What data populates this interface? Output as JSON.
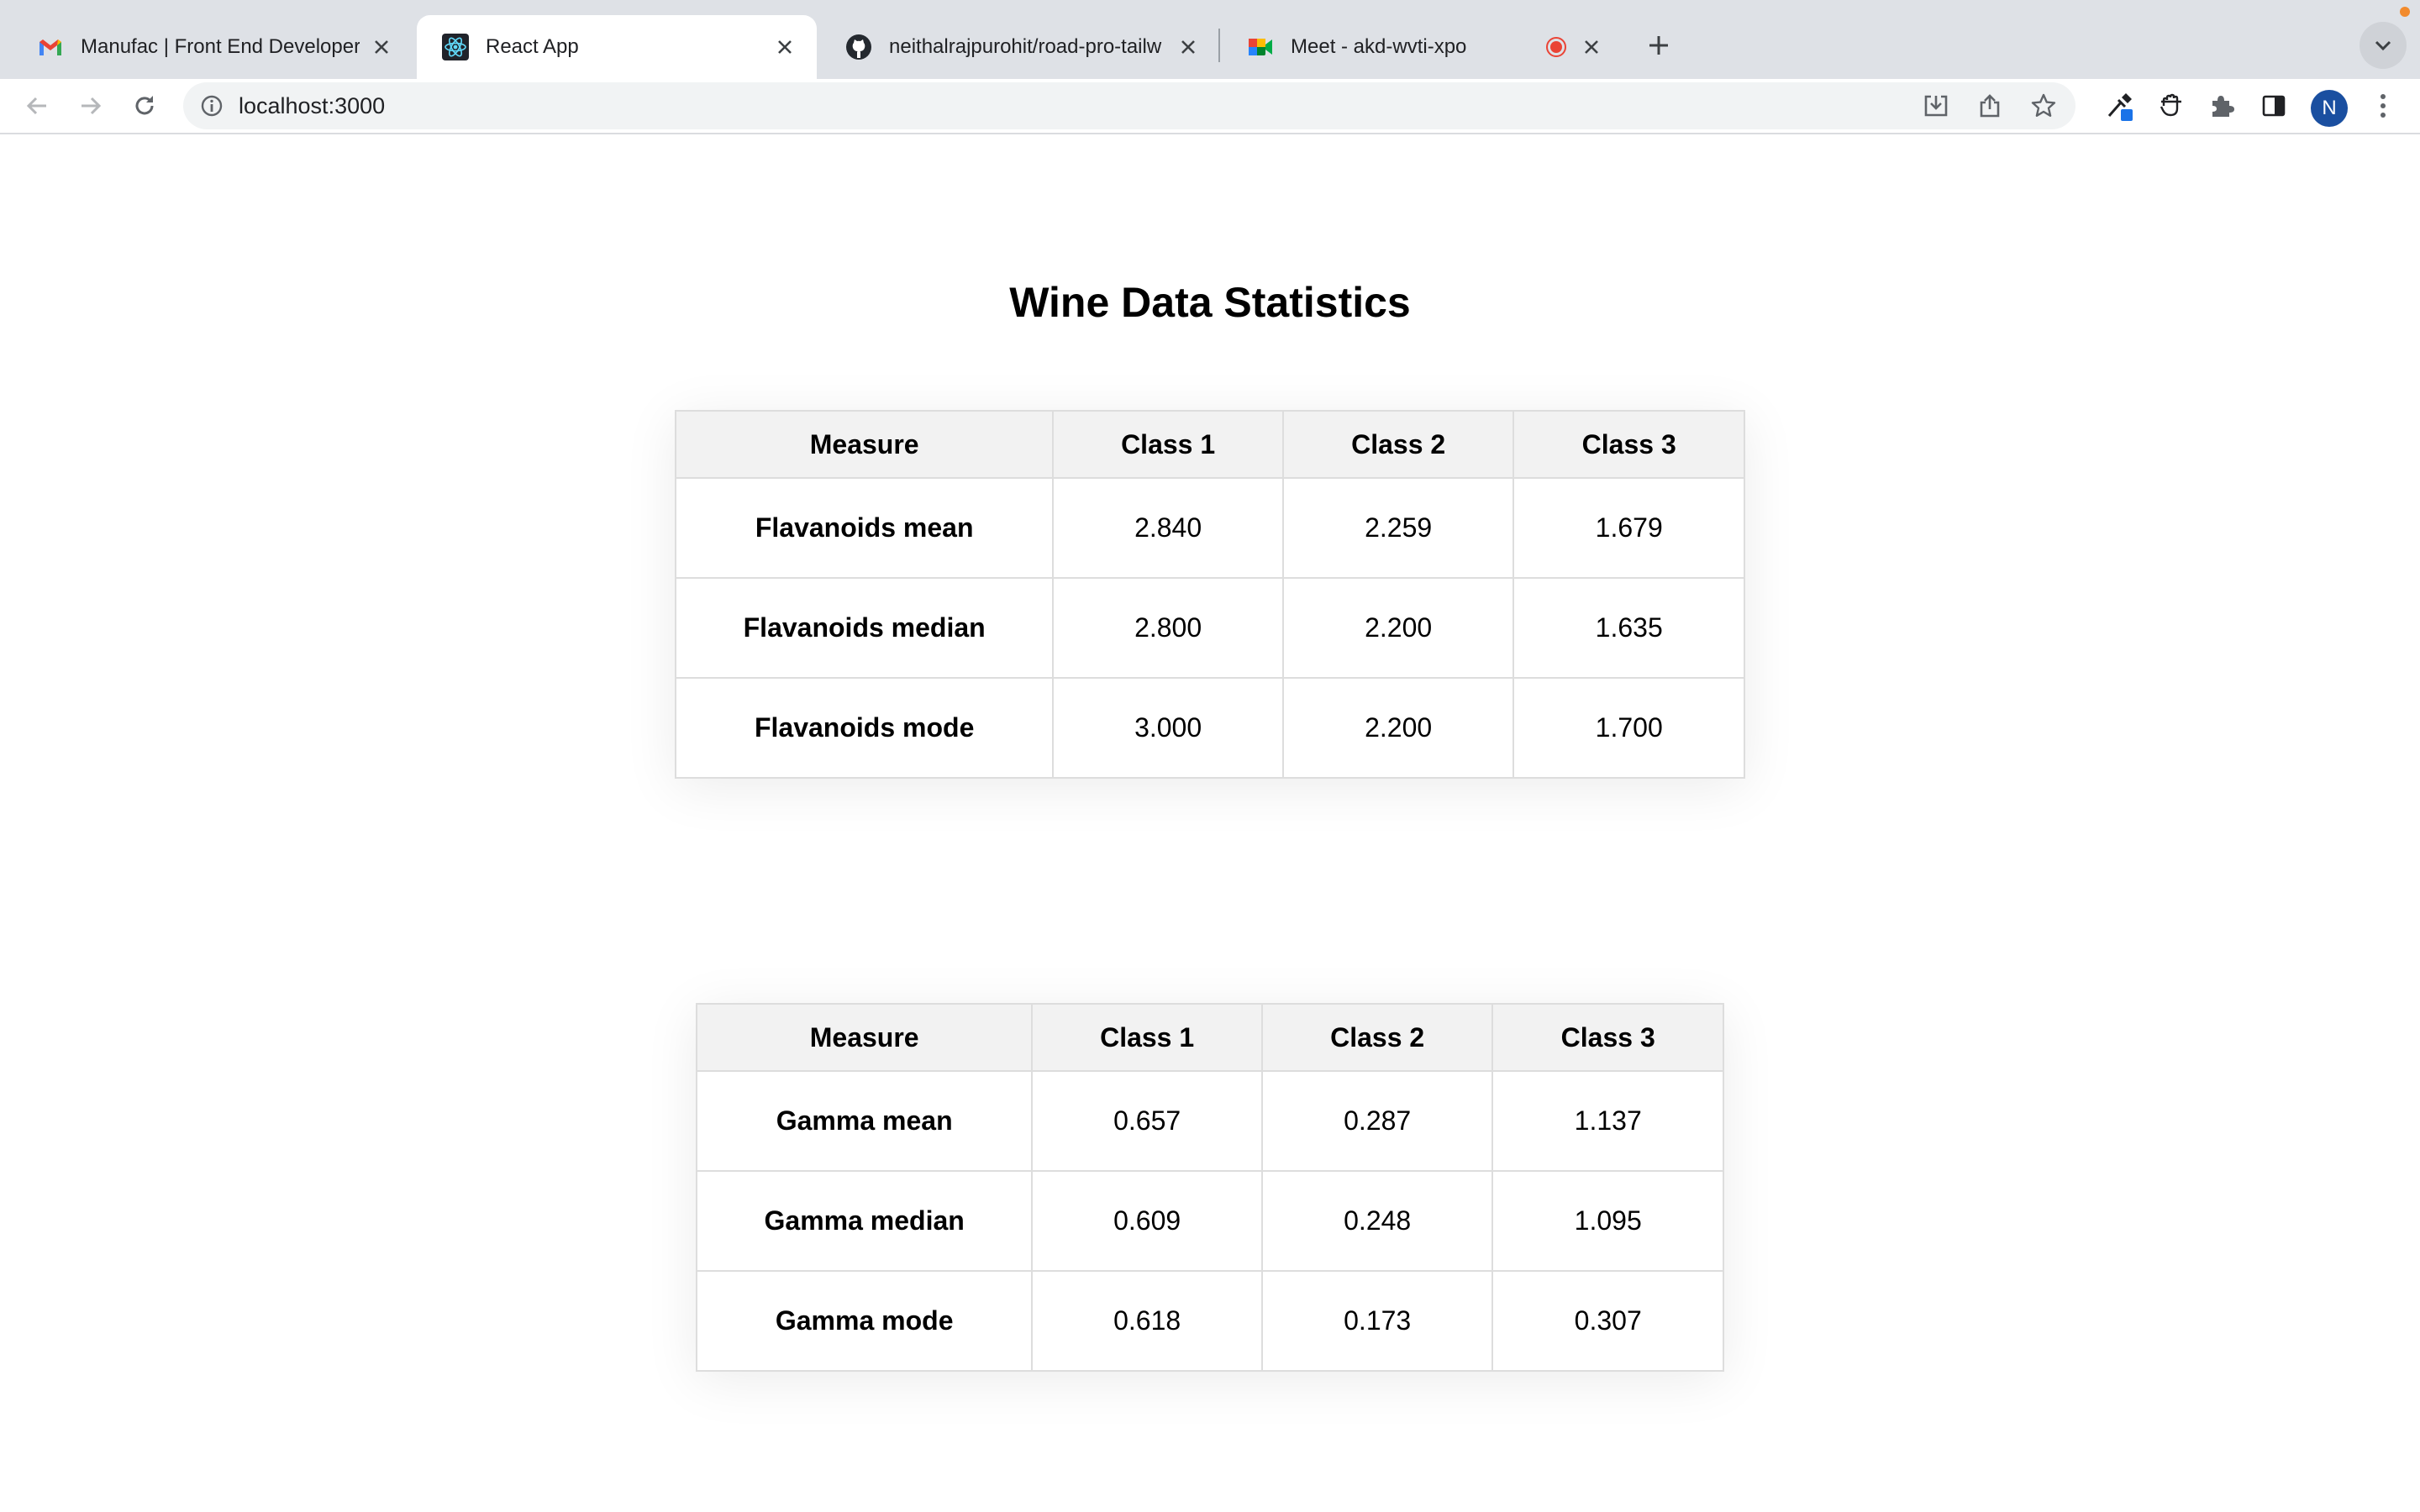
{
  "browser": {
    "tabs": [
      {
        "title": "Manufac | Front End Developer",
        "icon": "gmail-icon"
      },
      {
        "title": "React App",
        "icon": "react-icon"
      },
      {
        "title": "neithalrajpurohit/road-pro-tailw",
        "icon": "github-icon"
      },
      {
        "title": "Meet - akd-wvti-xpo",
        "icon": "google-meet-icon"
      }
    ],
    "url": "localhost:3000",
    "profile_initial": "N"
  },
  "page": {
    "title": "Wine Data Statistics",
    "tables": [
      {
        "headers": [
          "Measure",
          "Class 1",
          "Class 2",
          "Class 3"
        ],
        "rows": [
          [
            "Flavanoids mean",
            "2.840",
            "2.259",
            "1.679"
          ],
          [
            "Flavanoids median",
            "2.800",
            "2.200",
            "1.635"
          ],
          [
            "Flavanoids mode",
            "3.000",
            "2.200",
            "1.700"
          ]
        ]
      },
      {
        "headers": [
          "Measure",
          "Class 1",
          "Class 2",
          "Class 3"
        ],
        "rows": [
          [
            "Gamma mean",
            "0.657",
            "0.287",
            "1.137"
          ],
          [
            "Gamma median",
            "0.609",
            "0.248",
            "1.095"
          ],
          [
            "Gamma mode",
            "0.618",
            "0.173",
            "0.307"
          ]
        ]
      }
    ]
  },
  "colors": {
    "tabstrip_bg": "#dee1e6",
    "omnibox_bg": "#f1f3f4",
    "header_bg": "#f2f2f2",
    "border": "#dddddd",
    "avatar": "#1a4fa0",
    "recording": "#ea4335"
  }
}
